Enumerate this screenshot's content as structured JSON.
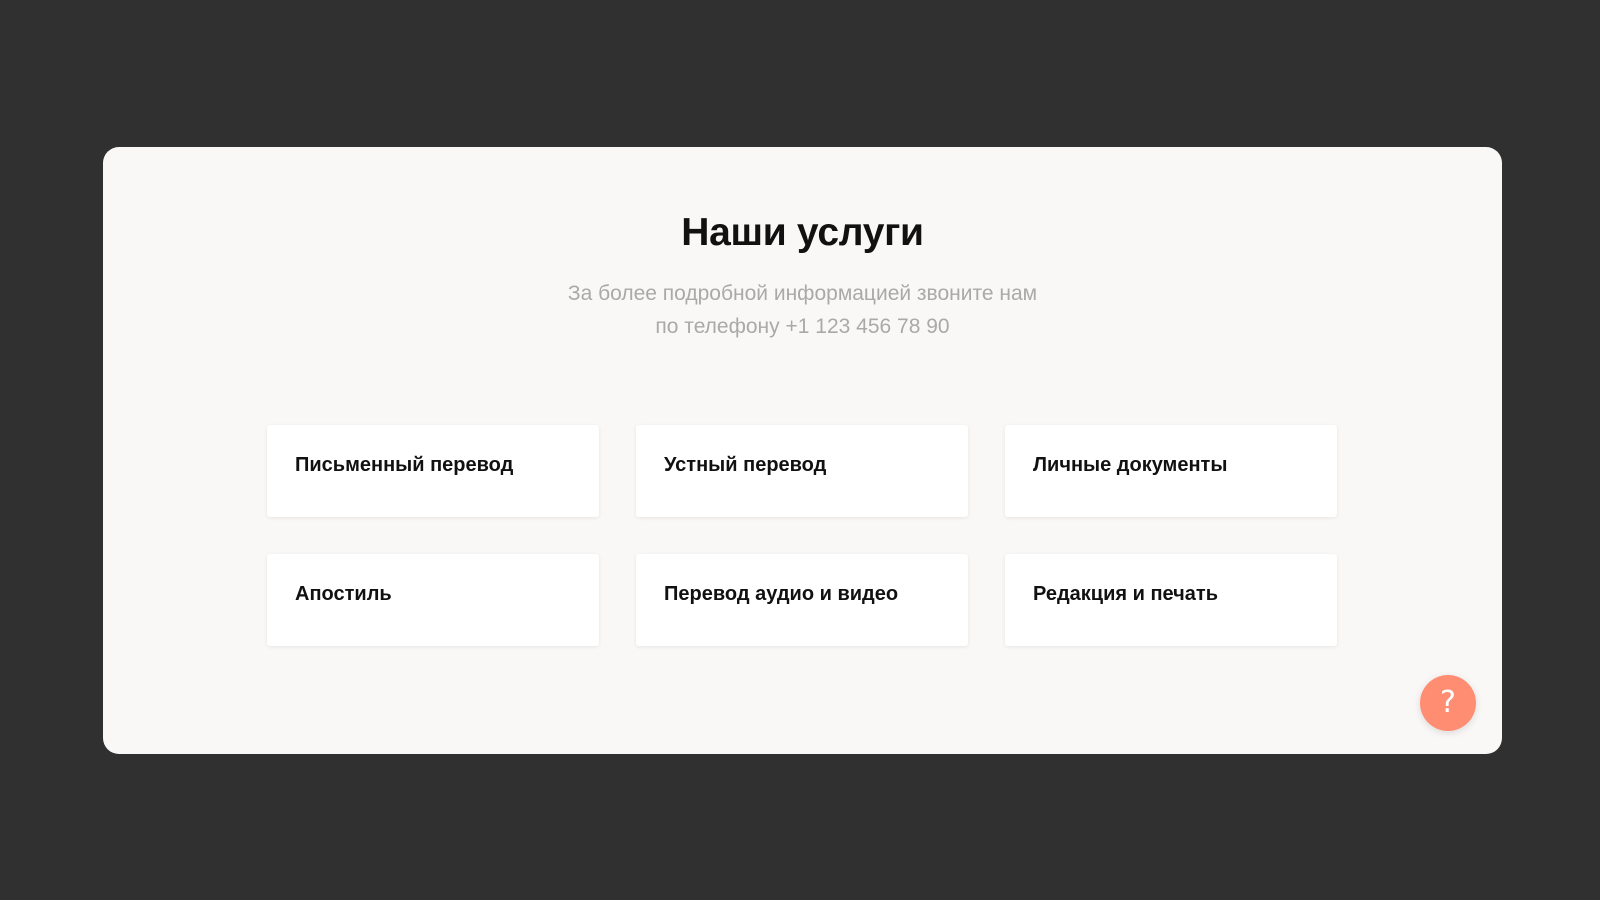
{
  "section": {
    "title": "Наши услуги",
    "subtitle_line1": "За более подробной информацией звоните нам",
    "subtitle_line2": "по телефону +1 123 456 78 90"
  },
  "services": [
    {
      "label": "Письменный перевод"
    },
    {
      "label": "Устный перевод"
    },
    {
      "label": "Личные документы"
    },
    {
      "label": "Апостиль"
    },
    {
      "label": "Перевод аудио и видео"
    },
    {
      "label": "Редакция и печать"
    }
  ],
  "help": {
    "icon": "question-icon",
    "glyph": "?",
    "color": "#ff8d72"
  },
  "colors": {
    "background": "#303030",
    "panel": "#faf8f7",
    "card": "#ffffff",
    "accent": "#ff8d72"
  }
}
